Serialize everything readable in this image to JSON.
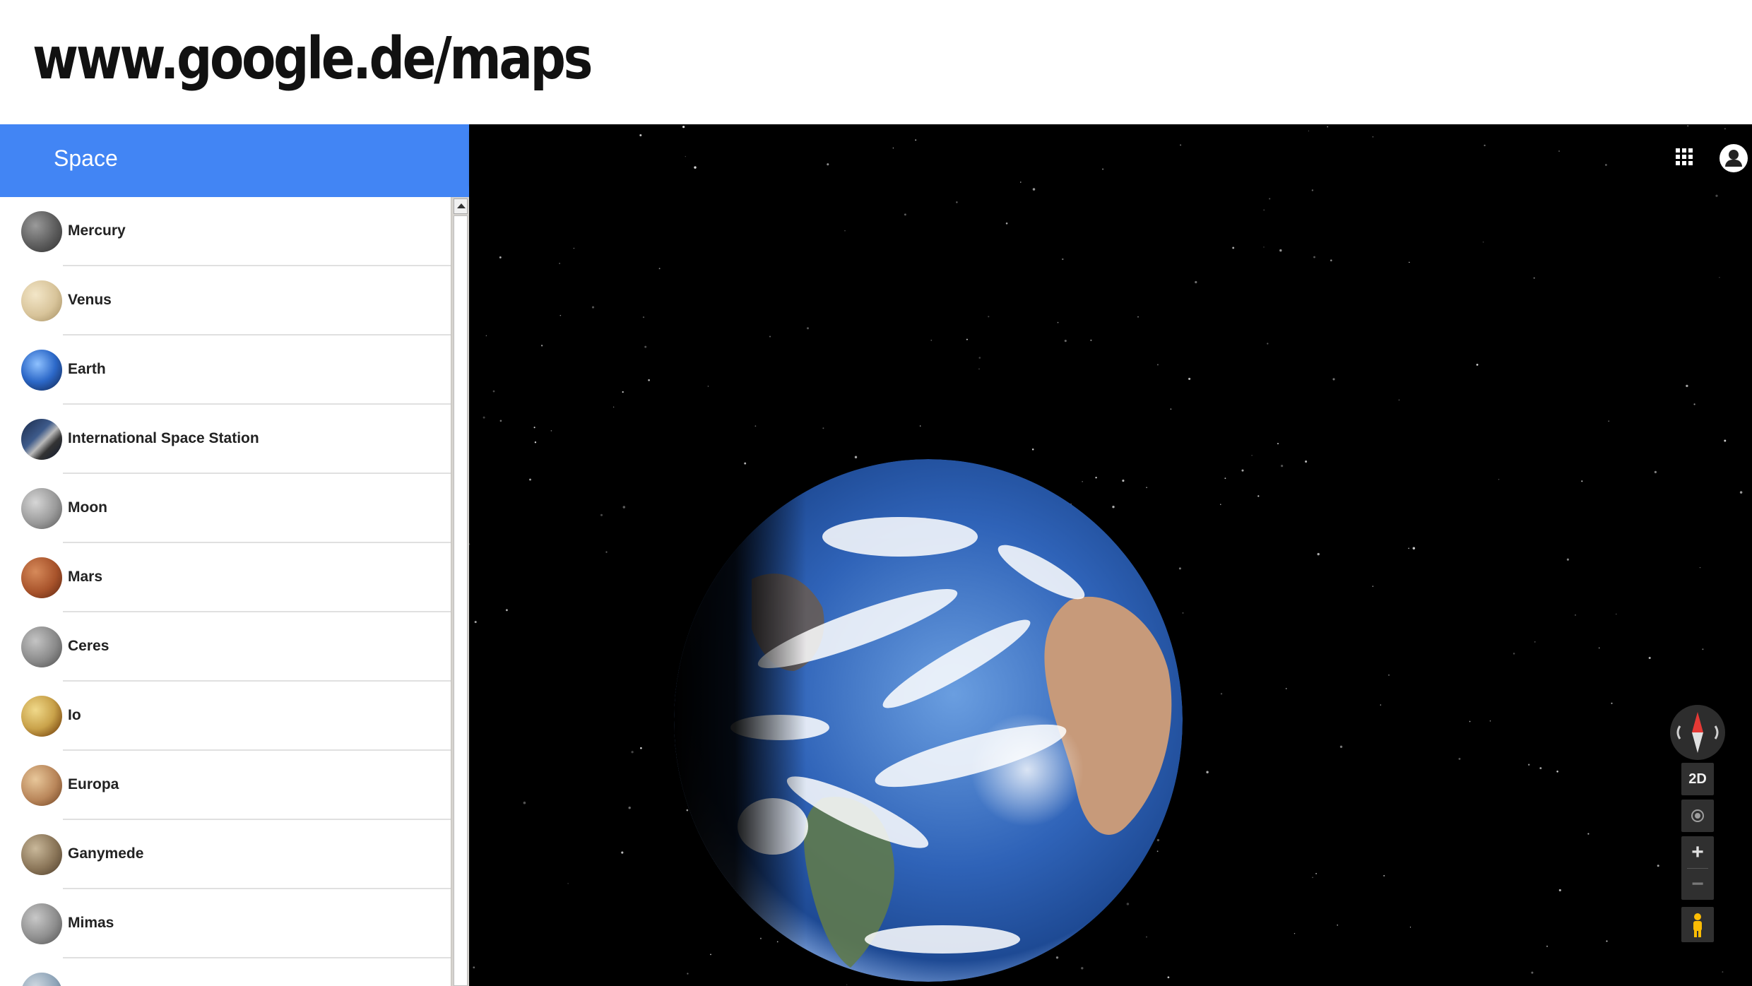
{
  "slide": {
    "title": "www.google.de/maps"
  },
  "sidebar": {
    "title": "Space",
    "items": [
      {
        "label": "Mercury",
        "icon": "mercury-icon"
      },
      {
        "label": "Venus",
        "icon": "venus-icon"
      },
      {
        "label": "Earth",
        "icon": "earth-icon"
      },
      {
        "label": "International Space Station",
        "icon": "iss-icon"
      },
      {
        "label": "Moon",
        "icon": "moon-icon"
      },
      {
        "label": "Mars",
        "icon": "mars-icon"
      },
      {
        "label": "Ceres",
        "icon": "ceres-icon"
      },
      {
        "label": "Io",
        "icon": "io-icon"
      },
      {
        "label": "Europa",
        "icon": "europa-icon"
      },
      {
        "label": "Ganymede",
        "icon": "ganymede-icon"
      },
      {
        "label": "Mimas",
        "icon": "mimas-icon"
      }
    ]
  },
  "map": {
    "view_toggle": "2D",
    "zoom_in": "+",
    "zoom_out": "−"
  },
  "colors": {
    "accent": "#4285f4",
    "map_background": "#000000"
  }
}
